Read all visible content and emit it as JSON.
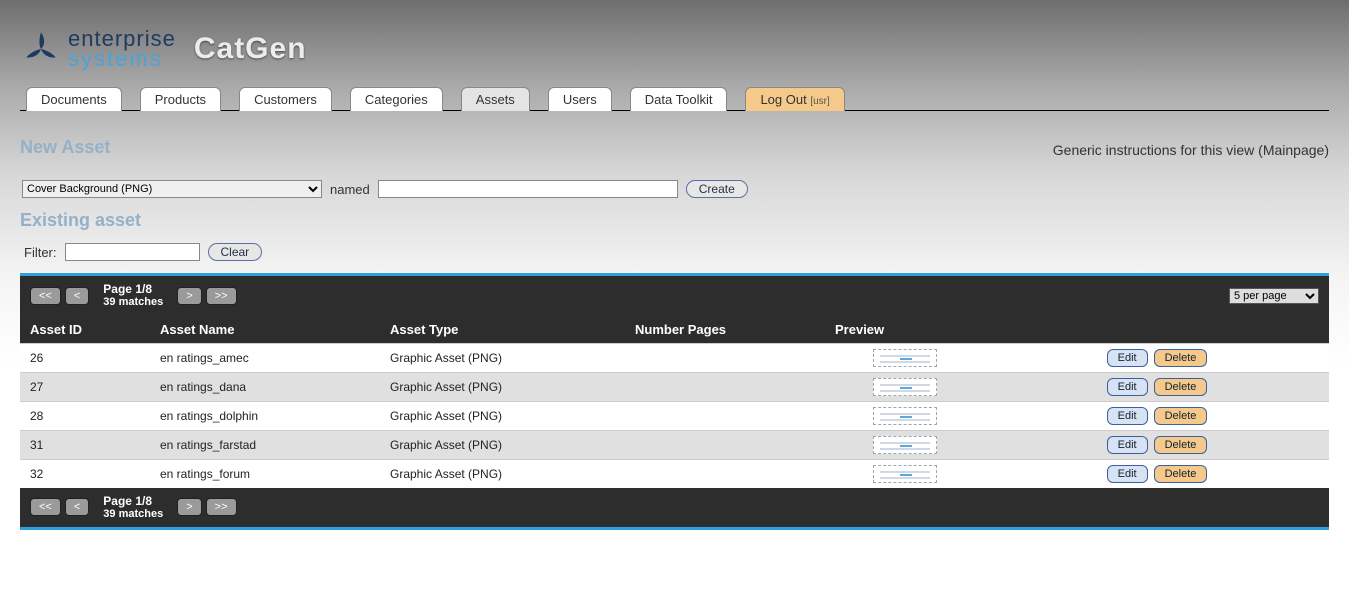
{
  "brand": {
    "line1": "enterprise",
    "line2": "systems",
    "app_name": "CatGen"
  },
  "tabs": {
    "documents": "Documents",
    "products": "Products",
    "customers": "Customers",
    "categories": "Categories",
    "assets": "Assets",
    "users": "Users",
    "toolkit": "Data Toolkit",
    "logout": "Log Out",
    "logout_user": "[usr]"
  },
  "instructions": "Generic instructions for this view (Mainpage)",
  "new_asset": {
    "heading": "New Asset",
    "type_selected": "Cover Background (PNG)",
    "named_label": "named",
    "name_value": "",
    "create_label": "Create"
  },
  "existing": {
    "heading": "Existing asset",
    "filter_label": "Filter:",
    "filter_value": "",
    "clear_label": "Clear"
  },
  "pager": {
    "first": "<<",
    "prev": "<",
    "next": ">",
    "last": ">>",
    "page_text": "Page 1/8",
    "matches_text": "39 matches",
    "per_page_selected": "5 per page"
  },
  "table": {
    "headers": {
      "id": "Asset ID",
      "name": "Asset Name",
      "type": "Asset Type",
      "pages": "Number Pages",
      "preview": "Preview"
    },
    "edit_label": "Edit",
    "delete_label": "Delete",
    "rows": [
      {
        "id": "26",
        "name": "en ratings_amec",
        "type": "Graphic Asset (PNG)",
        "pages": ""
      },
      {
        "id": "27",
        "name": "en ratings_dana",
        "type": "Graphic Asset (PNG)",
        "pages": ""
      },
      {
        "id": "28",
        "name": "en ratings_dolphin",
        "type": "Graphic Asset (PNG)",
        "pages": ""
      },
      {
        "id": "31",
        "name": "en ratings_farstad",
        "type": "Graphic Asset (PNG)",
        "pages": ""
      },
      {
        "id": "32",
        "name": "en ratings_forum",
        "type": "Graphic Asset (PNG)",
        "pages": ""
      }
    ]
  }
}
